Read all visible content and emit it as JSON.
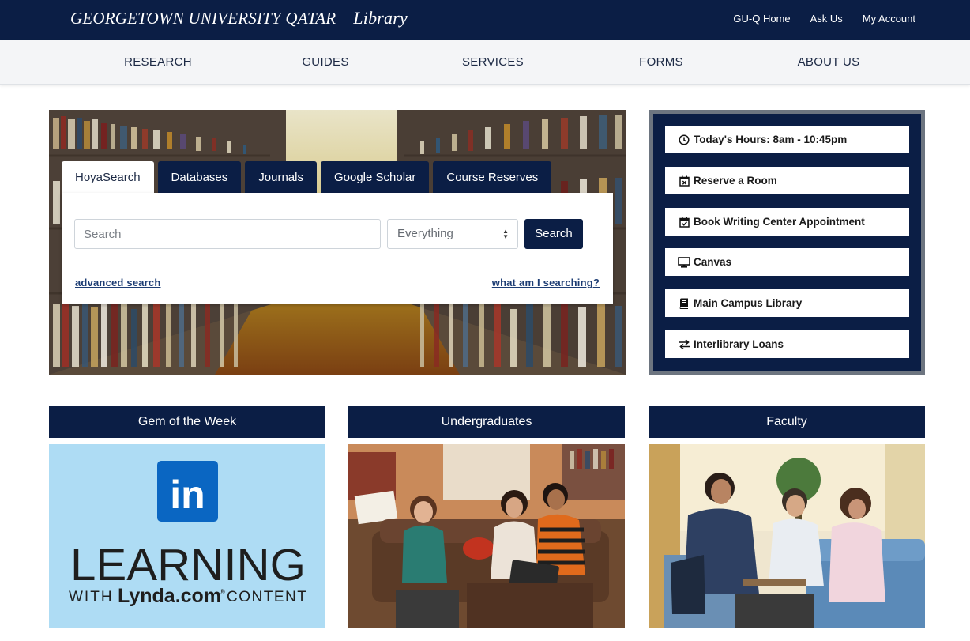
{
  "header": {
    "brand": "GEORGETOWN UNIVERSITY QATAR",
    "brand_sub": "Library",
    "links": [
      "GU-Q Home",
      "Ask Us",
      "My Account"
    ]
  },
  "nav": {
    "items": [
      "RESEARCH",
      "GUIDES",
      "SERVICES",
      "FORMS",
      "ABOUT US"
    ]
  },
  "search": {
    "tabs": [
      "HoyaSearch",
      "Databases",
      "Journals",
      "Google Scholar",
      "Course Reserves"
    ],
    "active_tab": "HoyaSearch",
    "placeholder": "Search",
    "scope": "Everything",
    "button": "Search",
    "advanced": "advanced search",
    "what": "what am I searching?"
  },
  "quick_links": [
    {
      "label": "Today's Hours: 8am - 10:45pm",
      "icon": "clock-icon"
    },
    {
      "label": "Reserve a Room",
      "icon": "calendar-x-icon"
    },
    {
      "label": "Book Writing Center Appointment",
      "icon": "calendar-check-icon"
    },
    {
      "label": "Canvas",
      "icon": "desktop-icon"
    },
    {
      "label": "Main Campus Library",
      "icon": "book-icon"
    },
    {
      "label": "Interlibrary Loans",
      "icon": "exchange-icon"
    }
  ],
  "cards": [
    {
      "title": "Gem of the Week"
    },
    {
      "title": "Undergraduates"
    },
    {
      "title": "Faculty"
    }
  ],
  "lynda": {
    "badge": "in",
    "word": "LEARNING",
    "line_with": "WITH",
    "line_brand": "Lynda.com",
    "line_reg": "®",
    "line_content": "CONTENT"
  },
  "colors": {
    "navy": "#0b1e45",
    "nav_bg": "#f4f5f7",
    "link": "#1d3d74",
    "linkedin_blue": "#0a66c2",
    "lynda_bg": "#aedcf4"
  }
}
